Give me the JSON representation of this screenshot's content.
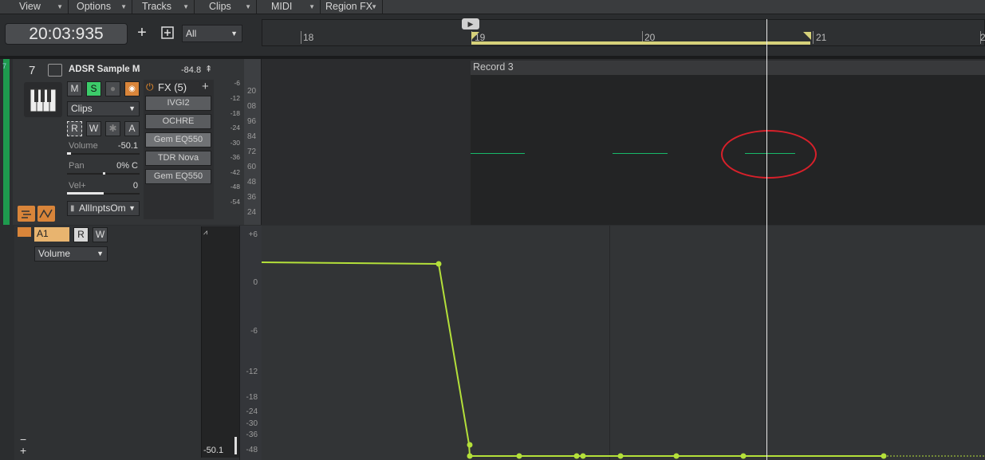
{
  "menu": [
    {
      "label": "View"
    },
    {
      "label": "Options"
    },
    {
      "label": "Tracks"
    },
    {
      "label": "Clips"
    },
    {
      "label": "MIDI"
    },
    {
      "label": "Region FX"
    }
  ],
  "toolbar": {
    "time": "20:03:935",
    "add_symbol": "+",
    "filter_value": "All"
  },
  "ruler": {
    "markers": [
      "18",
      "19",
      "20",
      "21",
      "2"
    ]
  },
  "track": {
    "number": "7",
    "name": "ADSR Sample Ma",
    "value": "-84.8",
    "mute": "M",
    "solo": "S",
    "clips_dropdown": "Clips",
    "read": "R",
    "write": "W",
    "automation_a": "A",
    "volume_label": "Volume",
    "volume_value": "-50.1",
    "pan_label": "Pan",
    "pan_value": "0% C",
    "vel_label": "Vel+",
    "vel_value": "0",
    "input": "AllInptsOm",
    "fx_title": "FX (5)",
    "fx": [
      "IVGI2",
      "OCHRE",
      "Gem EQ550",
      "TDR Nova",
      "Gem EQ550"
    ],
    "meter_labels": [
      "-6",
      "-12",
      "-18",
      "-24",
      "-30",
      "-36",
      "-42",
      "-48",
      "-54"
    ],
    "volume_fill": 0.06,
    "pan_fill": 0.5,
    "vel_fill": 0.5
  },
  "piano_roll": {
    "clip_title": "Record 3",
    "key_labels": [
      "20",
      "08",
      "96",
      "84",
      "72",
      "60",
      "48",
      "36",
      "24"
    ]
  },
  "automation": {
    "lane": "A1",
    "read": "R",
    "write": "W",
    "param": "Volume",
    "meter_value": "-50.1",
    "db_labels": [
      "+6",
      "0",
      "-6",
      "-12",
      "-18",
      "-24",
      "-30",
      "-36",
      "-48"
    ],
    "minus": "−",
    "plus": "+"
  },
  "colors": {
    "automation_line": "#b4e03a",
    "note": "#18b86a",
    "highlight_circle": "#d8202a",
    "track_color": "#1e9a4e"
  }
}
